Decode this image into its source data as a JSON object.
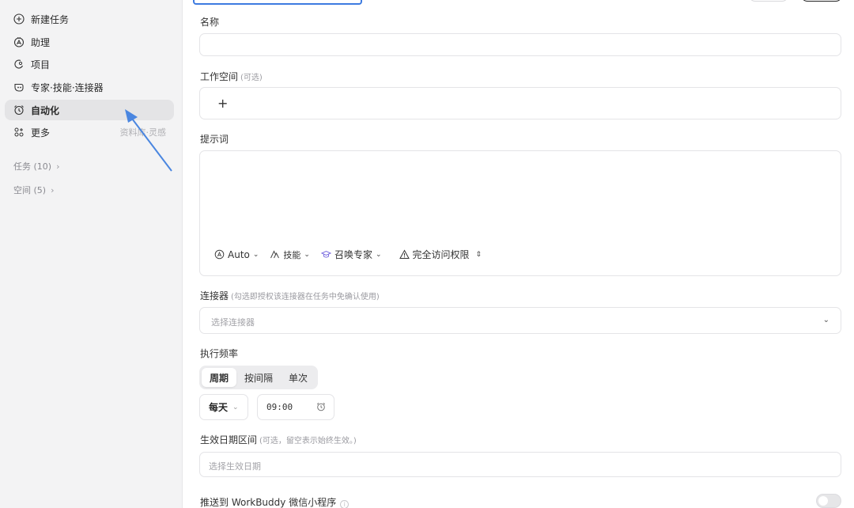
{
  "sidebar": {
    "items": [
      {
        "label": "新建任务",
        "icon": "plus-circle-icon"
      },
      {
        "label": "助理",
        "icon": "assistant-icon"
      },
      {
        "label": "项目",
        "icon": "project-icon"
      },
      {
        "label": "专家·技能·连接器",
        "icon": "expert-icon"
      },
      {
        "label": "自动化",
        "icon": "alarm-clock-icon",
        "active": true
      },
      {
        "label": "更多",
        "icon": "more-grid-icon",
        "hint": "资料库·灵感"
      }
    ],
    "groups": [
      {
        "label": "任务 (10)"
      },
      {
        "label": "空间 (5)"
      }
    ]
  },
  "form": {
    "name": {
      "label": "名称",
      "value": ""
    },
    "workspace": {
      "label": "工作空间",
      "sub": "(可选)",
      "add": "+"
    },
    "prompt": {
      "label": "提示词",
      "value": "",
      "tools": {
        "auto": "Auto",
        "skills": "技能",
        "expert": "召唤专家",
        "access": "完全访问权限"
      }
    },
    "connectors": {
      "label": "连接器",
      "sub": "(勾选即授权该连接器在任务中免确认使用)",
      "placeholder": "选择连接器"
    },
    "frequency": {
      "label": "执行频率",
      "modes": [
        "周期",
        "按间隔",
        "单次"
      ],
      "active_mode": "周期",
      "period": "每天",
      "time": "09:00"
    },
    "date_range": {
      "label": "生效日期区间",
      "sub": "(可选，留空表示始终生效。)",
      "placeholder": "选择生效日期"
    },
    "push": {
      "label": "推送到 WorkBuddy 微信小程序",
      "enabled": false
    }
  },
  "colors": {
    "accent": "#3d7be0",
    "sidebar_bg": "#f3f3f4",
    "active_item_bg": "#e4e4e6"
  }
}
